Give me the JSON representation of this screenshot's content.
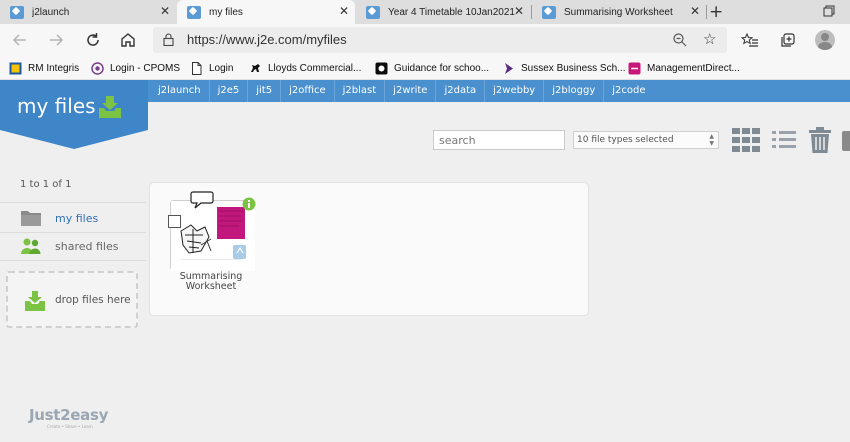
{
  "browser": {
    "tabs": [
      {
        "title": "j2launch",
        "active": false
      },
      {
        "title": "my files",
        "active": true
      },
      {
        "title": "Year 4 Timetable 10Jan2021",
        "active": false
      },
      {
        "title": "Summarising Worksheet",
        "active": false
      }
    ],
    "new_tab_label": "+",
    "close_label": "✕",
    "url": "https://www.j2e.com/myfiles",
    "bookmarks": [
      {
        "label": "RM Integris",
        "icon": "rm-icon"
      },
      {
        "label": "Login - CPOMS",
        "icon": "cpoms-icon"
      },
      {
        "label": "Login",
        "icon": "page-icon"
      },
      {
        "label": "Lloyds Commercial...",
        "icon": "lloyds-horse-icon"
      },
      {
        "label": "Guidance for schoo...",
        "icon": "gov-icon"
      },
      {
        "label": "Sussex Business Sch...",
        "icon": "sussex-icon"
      },
      {
        "label": "ManagementDirect...",
        "icon": "cie-icon"
      }
    ],
    "accent": "#4a8fce"
  },
  "app": {
    "title": "my files",
    "tools": [
      "j2launch",
      "j2e5",
      "jit5",
      "j2office",
      "j2blast",
      "j2write",
      "j2data",
      "j2webby",
      "j2bloggy",
      "j2code"
    ],
    "search_placeholder": "search",
    "filetypes_label": "10 file types selected",
    "count_text": "1 to 1 of 1",
    "sidebar": [
      {
        "label": "my files",
        "icon": "folder-icon",
        "active": true
      },
      {
        "label": "shared files",
        "icon": "people-icon",
        "active": false
      }
    ],
    "drop_label": "drop files here",
    "files": [
      {
        "name_line1": "Summarising",
        "name_line2": "Worksheet"
      }
    ],
    "logo": "Just2easy",
    "logo_tagline": "Create • Share • Learn"
  }
}
